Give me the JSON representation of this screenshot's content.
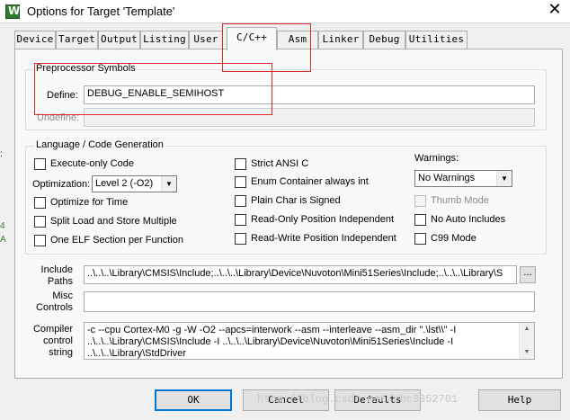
{
  "window": {
    "title": "Options for Target 'Template'",
    "app_icon_glyph": "W",
    "close_glyph": "✕"
  },
  "tabs": [
    {
      "label": "Device",
      "active": false
    },
    {
      "label": "Target",
      "active": false
    },
    {
      "label": "Output",
      "active": false
    },
    {
      "label": "Listing",
      "active": false
    },
    {
      "label": "User",
      "active": false
    },
    {
      "label": "C/C++",
      "active": true
    },
    {
      "label": "Asm",
      "active": false
    },
    {
      "label": "Linker",
      "active": false
    },
    {
      "label": "Debug",
      "active": false
    },
    {
      "label": "Utilities",
      "active": false
    }
  ],
  "preprocessor": {
    "legend": "Preprocessor Symbols",
    "define_label": "Define:",
    "define_value": "DEBUG_ENABLE_SEMIHOST",
    "undefine_label": "Undefine:",
    "undefine_value": ""
  },
  "language": {
    "legend": "Language / Code Generation",
    "execute_only": {
      "label": "Execute-only Code",
      "checked": false
    },
    "optimization_label": "Optimization:",
    "optimization_value": "Level 2 (-O2)",
    "optimize_time": {
      "label": "Optimize for Time",
      "checked": false
    },
    "split_load": {
      "label": "Split Load and Store Multiple",
      "checked": false
    },
    "one_elf": {
      "label": "One ELF Section per Function",
      "checked": false
    },
    "strict_ansi": {
      "label": "Strict ANSI C",
      "checked": false
    },
    "enum_container": {
      "label": "Enum Container always int",
      "checked": false
    },
    "plain_char": {
      "label": "Plain Char is Signed",
      "checked": false
    },
    "ro_position": {
      "label": "Read-Only Position Independent",
      "checked": false
    },
    "rw_position": {
      "label": "Read-Write Position Independent",
      "checked": false
    },
    "warnings_label": "Warnings:",
    "warnings_value": "No Warnings",
    "thumb_mode": {
      "label": "Thumb Mode",
      "checked": false,
      "enabled": false
    },
    "no_auto_includes": {
      "label": "No Auto Includes",
      "checked": false
    },
    "c99_mode": {
      "label": "C99 Mode",
      "checked": false
    }
  },
  "include_paths": {
    "label_line1": "Include",
    "label_line2": "Paths",
    "value": "..\\..\\..\\Library\\CMSIS\\Include;..\\..\\..\\Library\\Device\\Nuvoton\\Mini51Series\\Include;..\\..\\..\\Library\\S",
    "browse_label": "..."
  },
  "misc_controls": {
    "label_line1": "Misc",
    "label_line2": "Controls",
    "value": ""
  },
  "compiler_control": {
    "label_line1": "Compiler",
    "label_line2": "control",
    "label_line3": "string",
    "value": "-c --cpu Cortex-M0 -g -W -O2 --apcs=interwork --asm --interleave --asm_dir \".\\lst\\\\\" -I ..\\..\\..\\Library\\CMSIS\\Include -I ..\\..\\..\\Library\\Device\\Nuvoton\\Mini51Series\\Include -I ..\\..\\..\\Library\\StdDriver"
  },
  "buttons": {
    "ok": "OK",
    "cancel": "Cancel",
    "defaults": "Defaults",
    "help": "Help"
  },
  "watermark": "http://blog.csdn.net/zhc3352701",
  "edge_marks": [
    ":",
    "4",
    "A"
  ],
  "colors": {
    "highlight": "#e0282c",
    "default_button_border": "#0078d7"
  }
}
